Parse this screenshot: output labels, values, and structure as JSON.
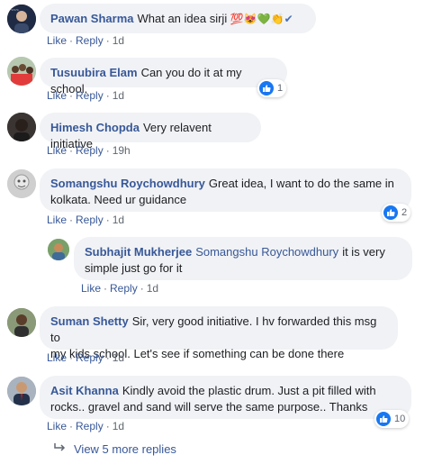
{
  "comments": [
    {
      "author": "Pawan Sharma",
      "text": "What an idea sirji",
      "emojis": [
        "💯",
        "😻",
        "💚",
        "👏",
        "✔"
      ],
      "actions": {
        "like": "Like",
        "reply": "Reply",
        "time": "1d"
      }
    },
    {
      "author": "Tusuubira Elam",
      "text": "Can you do it at my school.",
      "actions": {
        "like": "Like",
        "reply": "Reply",
        "time": "1d"
      },
      "reactions": "1"
    },
    {
      "author": "Himesh Chopda",
      "text": "Very relavent initiative",
      "actions": {
        "like": "Like",
        "reply": "Reply",
        "time": "19h"
      }
    },
    {
      "author": "Somangshu Roychowdhury",
      "text_line1": "Great idea, I want to do the same in",
      "text_line2": "kolkata. Need ur guidance",
      "actions": {
        "like": "Like",
        "reply": "Reply",
        "time": "1d"
      },
      "reactions": "2"
    },
    {
      "author": "Subhajit Mukherjee",
      "mention": "Somangshu Roychowdhury",
      "text_line1": "it is very",
      "text_line2": "simple just go for it",
      "actions": {
        "like": "Like",
        "reply": "Reply",
        "time": "1d"
      }
    },
    {
      "author": "Suman Shetty",
      "text_line1": "Sir, very good initiative. I hv forwarded this msg to",
      "text_line2": "my kids school. Let's see if something can be done there",
      "actions": {
        "like": "Like",
        "reply": "Reply",
        "time": "1d"
      }
    },
    {
      "author": "Asit Khanna",
      "text_line1": "Kindly avoid the plastic drum. Just a pit filled with",
      "text_line2": "rocks.. gravel and sand will serve the same purpose.. Thanks",
      "actions": {
        "like": "Like",
        "reply": "Reply",
        "time": "1d"
      },
      "reactions": "10"
    }
  ],
  "more_replies": "View 5 more replies",
  "colors": {
    "link": "#385898",
    "bubble": "#f0f2f5",
    "like_blue": "#1877f2",
    "meta": "#606770"
  }
}
